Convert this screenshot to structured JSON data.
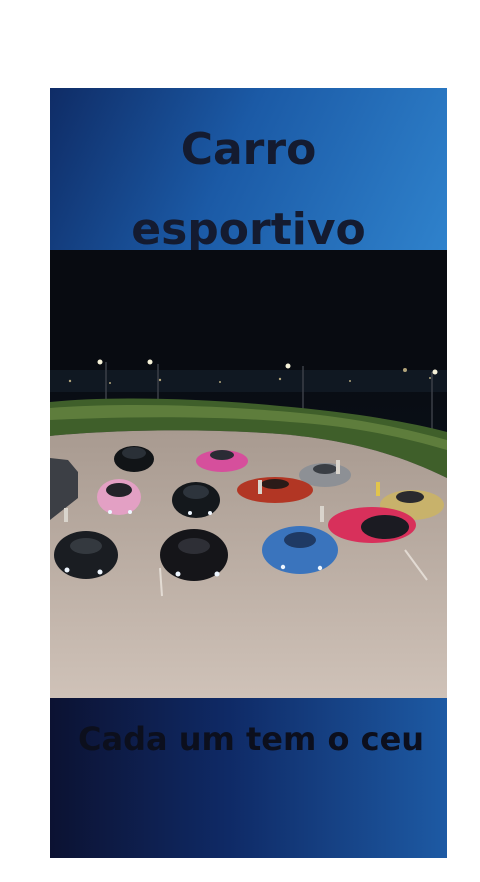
{
  "post": {
    "title_line1": "Carro",
    "title_line2": "esportivo",
    "caption": "Cada um tem o ceu"
  },
  "colors": {
    "top_banner": "#1b5aa6",
    "bottom_banner": "#0f2a66",
    "text": "#141b30"
  }
}
